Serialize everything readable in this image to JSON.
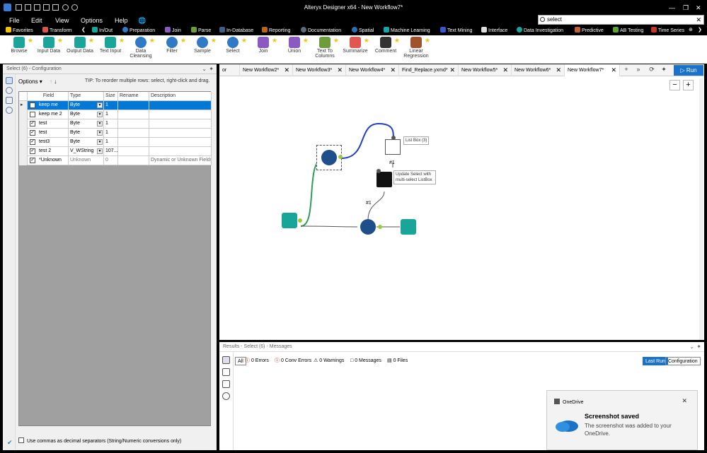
{
  "window": {
    "title": "Alteryx Designer x64 - New Workflow7*",
    "search_value": "select"
  },
  "menu": [
    "File",
    "Edit",
    "View",
    "Options",
    "Help"
  ],
  "categories": [
    {
      "label": "Favorites",
      "color": "#f4c20d"
    },
    {
      "label": "Transform",
      "color": "#d9534f"
    },
    {
      "label": "In/Out",
      "color": "#1aa59a"
    },
    {
      "label": "Preparation",
      "color": "#2f79c7"
    },
    {
      "label": "Join",
      "color": "#8a5ac2"
    },
    {
      "label": "Parse",
      "color": "#6d9c3a"
    },
    {
      "label": "In-Database",
      "color": "#445c8a"
    },
    {
      "label": "Reporting",
      "color": "#b5651d"
    },
    {
      "label": "Documentation",
      "color": "#5a6b7c"
    },
    {
      "label": "Spatial",
      "color": "#2b6fb3"
    },
    {
      "label": "Machine Learning",
      "color": "#1aa5a5"
    },
    {
      "label": "Text Mining",
      "color": "#3a56c9"
    },
    {
      "label": "Interface",
      "color": "#dddddd"
    },
    {
      "label": "Data Investigation",
      "color": "#1aa59a"
    },
    {
      "label": "Predictive",
      "color": "#c0603a"
    },
    {
      "label": "AB Testing",
      "color": "#5aa33a"
    },
    {
      "label": "Time Series",
      "color": "#c0392b"
    }
  ],
  "tools": [
    {
      "label": "Browse",
      "color": "#1aa59a"
    },
    {
      "label": "Input Data",
      "color": "#1aa59a"
    },
    {
      "label": "Output Data",
      "color": "#1aa59a"
    },
    {
      "label": "Text Input",
      "color": "#1aa59a"
    },
    {
      "label": "Data Cleansing",
      "color": "#2f79c7"
    },
    {
      "label": "Filter",
      "color": "#2f79c7"
    },
    {
      "label": "Sample",
      "color": "#2f79c7"
    },
    {
      "label": "Select",
      "color": "#2f79c7"
    },
    {
      "label": "Join",
      "color": "#8a5ac2"
    },
    {
      "label": "Union",
      "color": "#8a5ac2"
    },
    {
      "label": "Text To Columns",
      "color": "#6d9c3a"
    },
    {
      "label": "Summarize",
      "color": "#e0574f"
    },
    {
      "label": "Comment",
      "color": "#333333"
    },
    {
      "label": "Linear Regression",
      "color": "#a0522d"
    }
  ],
  "config": {
    "title": "Select (6) - Configuration",
    "options_label": "Options",
    "tip": "TIP: To reorder multiple rows: select, right-click and drag.",
    "headers": [
      "Field",
      "Type",
      "Size",
      "Rename",
      "Description"
    ],
    "rows": [
      {
        "checked": false,
        "field": "keep me",
        "type": "Byte",
        "size": "1",
        "rename": "",
        "description": "",
        "selected": true
      },
      {
        "checked": false,
        "field": "keep me 2",
        "type": "Byte",
        "size": "1",
        "rename": "",
        "description": "",
        "selected": false
      },
      {
        "checked": true,
        "field": "test",
        "type": "Byte",
        "size": "1",
        "rename": "",
        "description": "",
        "selected": false
      },
      {
        "checked": true,
        "field": "test",
        "type": "Byte",
        "size": "1",
        "rename": "",
        "description": "",
        "selected": false
      },
      {
        "checked": true,
        "field": "test3",
        "type": "Byte",
        "size": "1",
        "rename": "",
        "description": "",
        "selected": false
      },
      {
        "checked": true,
        "field": "test 2",
        "type": "V_WString",
        "size": "107...",
        "rename": "",
        "description": "",
        "selected": false
      },
      {
        "checked": true,
        "field": "*Unknown",
        "type": "Unknown",
        "size": "0",
        "rename": "",
        "description": "Dynamic or Unknown Fields",
        "selected": false
      }
    ],
    "footer": "Use commas as decimal separators (String/Numeric conversions only)"
  },
  "tabs": [
    {
      "label": "or",
      "active": false
    },
    {
      "label": "New Workflow2*",
      "active": false
    },
    {
      "label": "New Workflow3*",
      "active": false
    },
    {
      "label": "New Workflow4*",
      "active": false
    },
    {
      "label": "Find_Replace.yxmd*",
      "active": false
    },
    {
      "label": "New Workflow5*",
      "active": false
    },
    {
      "label": "New Workflow6*",
      "active": false
    },
    {
      "label": "New Workflow7*",
      "active": true
    }
  ],
  "run_label": "Run",
  "canvas": {
    "listbox_label": "List Box (3)",
    "update_label": "Update Select with multi-select ListBox",
    "conn1": "#1",
    "conn2": "#1"
  },
  "results": {
    "title": "Results - Select (6) - Messages",
    "all": "All",
    "errors": "0 Errors",
    "conv_errors": "0 Conv Errors",
    "warnings": "0 Warnings",
    "messages": "0 Messages",
    "files": "0 Files",
    "last_run": "Last Run",
    "configuration": "Configuration"
  },
  "toast": {
    "app": "OneDrive",
    "title": "Screenshot saved",
    "message": "The screenshot was added to your OneDrive."
  }
}
